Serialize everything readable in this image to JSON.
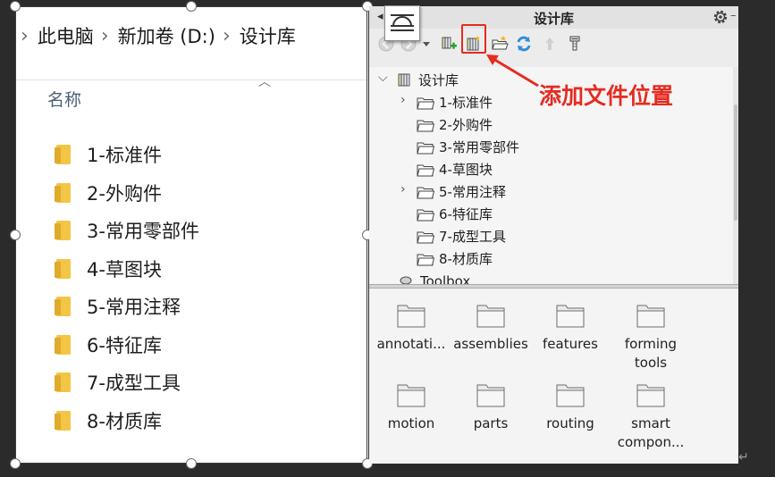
{
  "explorer": {
    "breadcrumb": [
      "此电脑",
      "新加卷 (D:)",
      "设计库"
    ],
    "column_header": "名称",
    "folders": [
      "1-标准件",
      "2-外购件",
      "3-常用零部件",
      "4-草图块",
      "5-常用注释",
      "6-特征库",
      "7-成型工具",
      "8-材质库"
    ],
    "folder_color": "#f3c544"
  },
  "design_library": {
    "title": "设计库",
    "tree_root": "设计库",
    "tree_items": [
      {
        "label": "1-标准件",
        "expandable": true
      },
      {
        "label": "2-外购件",
        "expandable": false
      },
      {
        "label": "3-常用零部件",
        "expandable": false
      },
      {
        "label": "4-草图块",
        "expandable": false
      },
      {
        "label": "5-常用注释",
        "expandable": true
      },
      {
        "label": "6-特征库",
        "expandable": false
      },
      {
        "label": "7-成型工具",
        "expandable": false
      },
      {
        "label": "8-材质库",
        "expandable": false
      }
    ],
    "tree_cut_item": "Toolbox",
    "grid_items": [
      "annotati...",
      "assemblies",
      "features",
      "forming tools",
      "motion",
      "parts",
      "routing",
      "smart compon..."
    ]
  },
  "annotation": {
    "text": "添加文件位置",
    "color": "#e52b20"
  },
  "icons": [
    "gear-icon",
    "back-icon",
    "forward-icon",
    "add-library-icon",
    "add-file-location-icon",
    "create-folder-icon",
    "refresh-icon",
    "up-icon",
    "options-icon",
    "folder-icon"
  ]
}
